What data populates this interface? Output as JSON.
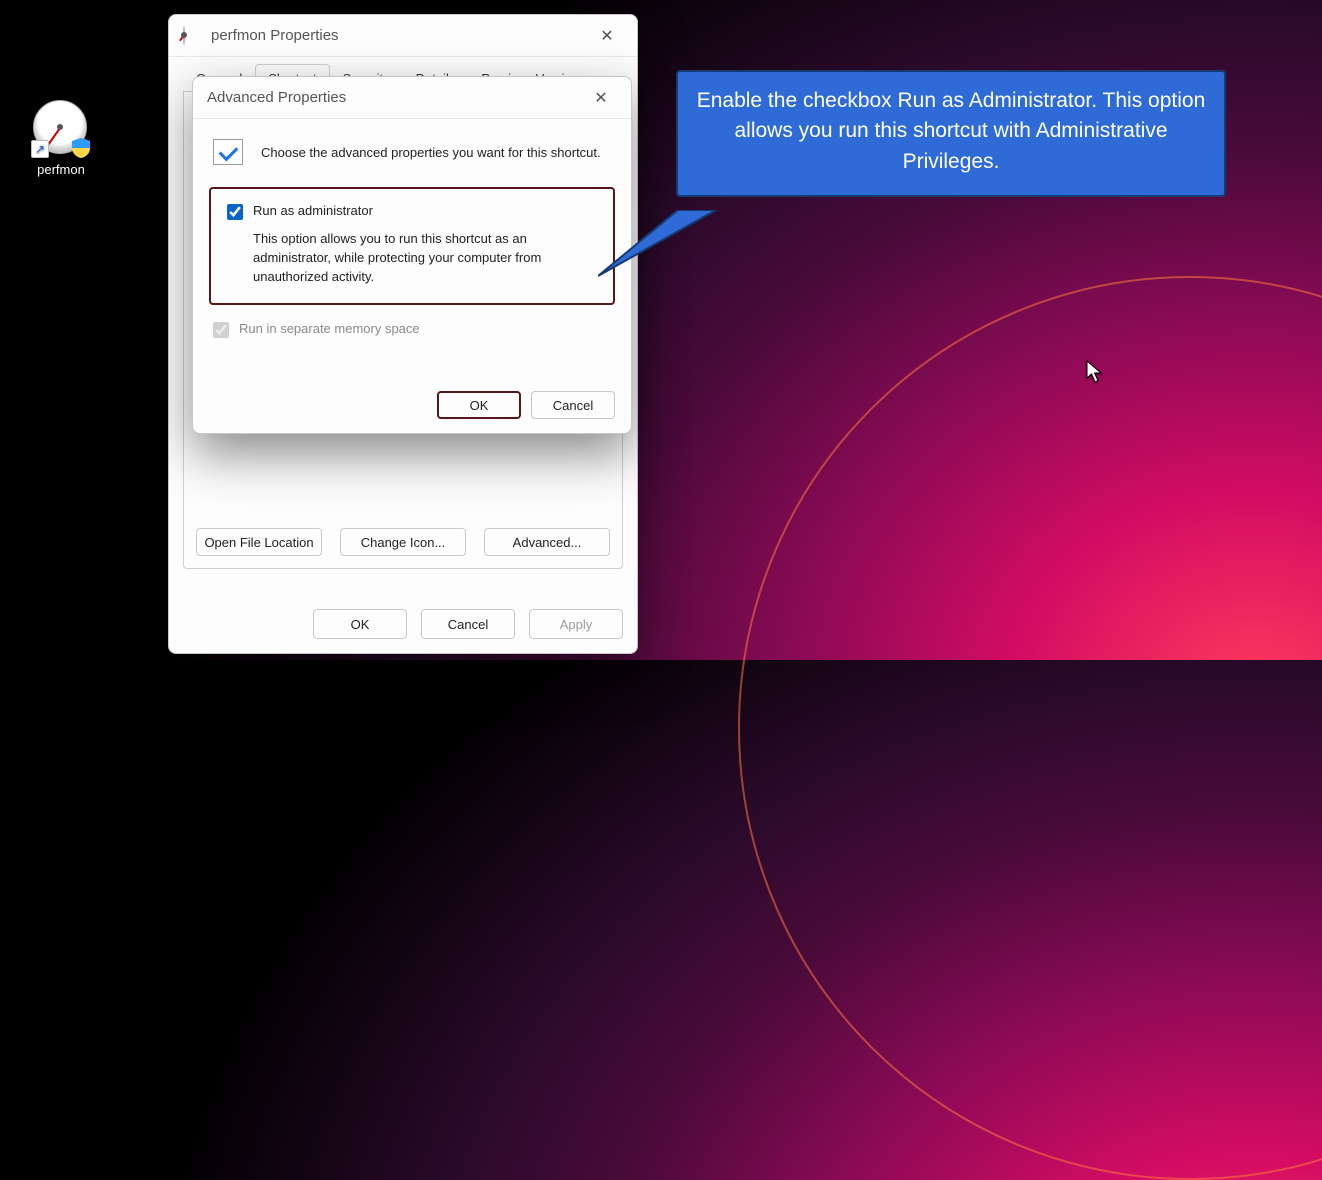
{
  "desktop": {
    "icon_label": "perfmon"
  },
  "properties_window": {
    "title": "perfmon Properties",
    "tabs": [
      "General",
      "Shortcut",
      "Security",
      "Details",
      "Previous Versions"
    ],
    "active_tab_index": 1,
    "shortcut_buttons": {
      "open_file_location": "Open File Location",
      "change_icon": "Change Icon...",
      "advanced": "Advanced..."
    },
    "footer": {
      "ok": "OK",
      "cancel": "Cancel",
      "apply": "Apply"
    }
  },
  "advanced_dialog": {
    "title": "Advanced Properties",
    "intro": "Choose the advanced properties you want for this shortcut.",
    "run_as_admin": {
      "label": "Run as administrator",
      "checked": true,
      "description": "This option allows you to run this shortcut as an administrator, while protecting your computer from unauthorized activity."
    },
    "separate_memory": {
      "label": "Run in separate memory space",
      "checked": true,
      "enabled": false
    },
    "footer": {
      "ok": "OK",
      "cancel": "Cancel"
    }
  },
  "annotation": {
    "text": "Enable the checkbox Run as Administrator. This option allows you run this shortcut with Administrative Privileges."
  }
}
